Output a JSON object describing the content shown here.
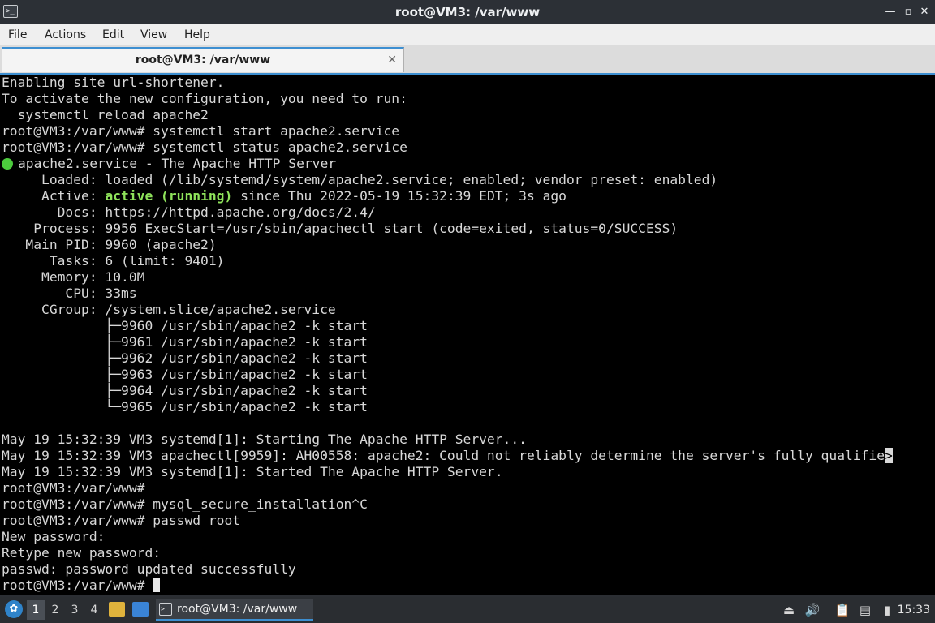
{
  "window": {
    "title": "root@VM3: /var/www",
    "app_icon": "terminal-icon",
    "minimize_glyph": "—",
    "maximize_glyph": "▫",
    "close_glyph": "✕"
  },
  "menu": [
    "File",
    "Actions",
    "Edit",
    "View",
    "Help"
  ],
  "tab": {
    "label": "root@VM3: /var/www",
    "close_glyph": "✕"
  },
  "terminal": {
    "lines": [
      "Enabling site url-shortener.",
      "To activate the new configuration, you need to run:",
      "  systemctl reload apache2",
      "root@VM3:/var/www# systemctl start apache2.service",
      "root@VM3:/var/www# systemctl status apache2.service",
      "apache2.service - The Apache HTTP Server",
      "     Loaded: loaded (/lib/systemd/system/apache2.service; enabled; vendor preset: enabled)",
      "     Active: ",
      "       Docs: https://httpd.apache.org/docs/2.4/",
      "    Process: 9956 ExecStart=/usr/sbin/apachectl start (code=exited, status=0/SUCCESS)",
      "   Main PID: 9960 (apache2)",
      "      Tasks: 6 (limit: 9401)",
      "     Memory: 10.0M",
      "        CPU: 33ms",
      "     CGroup: /system.slice/apache2.service",
      "             ├─9960 /usr/sbin/apache2 -k start",
      "             ├─9961 /usr/sbin/apache2 -k start",
      "             ├─9962 /usr/sbin/apache2 -k start",
      "             ├─9963 /usr/sbin/apache2 -k start",
      "             ├─9964 /usr/sbin/apache2 -k start",
      "             └─9965 /usr/sbin/apache2 -k start",
      "",
      "May 19 15:32:39 VM3 systemd[1]: Starting The Apache HTTP Server...",
      "May 19 15:32:39 VM3 apachectl[9959]: AH00558: apache2: Could not reliably determine the server's fully qualifie",
      "May 19 15:32:39 VM3 systemd[1]: Started The Apache HTTP Server.",
      "root@VM3:/var/www#",
      "root@VM3:/var/www# mysql_secure_installation^C",
      "root@VM3:/var/www# passwd root",
      "New password:",
      "Retype new password:",
      "passwd: password updated successfully",
      "root@VM3:/var/www# "
    ],
    "active_state": "active (running)",
    "active_rest": " since Thu 2022-05-19 15:32:39 EDT; 3s ago",
    "truncation_marker": ">",
    "status_color": "#4ccb3d",
    "highlight_color": "#8fe35b"
  },
  "taskbar": {
    "start_icon": "start-menu-icon",
    "workspaces": [
      "1",
      "2",
      "3",
      "4"
    ],
    "active_workspace": "1",
    "task_label": "root@VM3: /var/www",
    "clock": "15:33",
    "tray_icons": [
      "eject-icon",
      "volume-icon",
      "clipboard-icon",
      "network-icon",
      "power-icon"
    ]
  }
}
